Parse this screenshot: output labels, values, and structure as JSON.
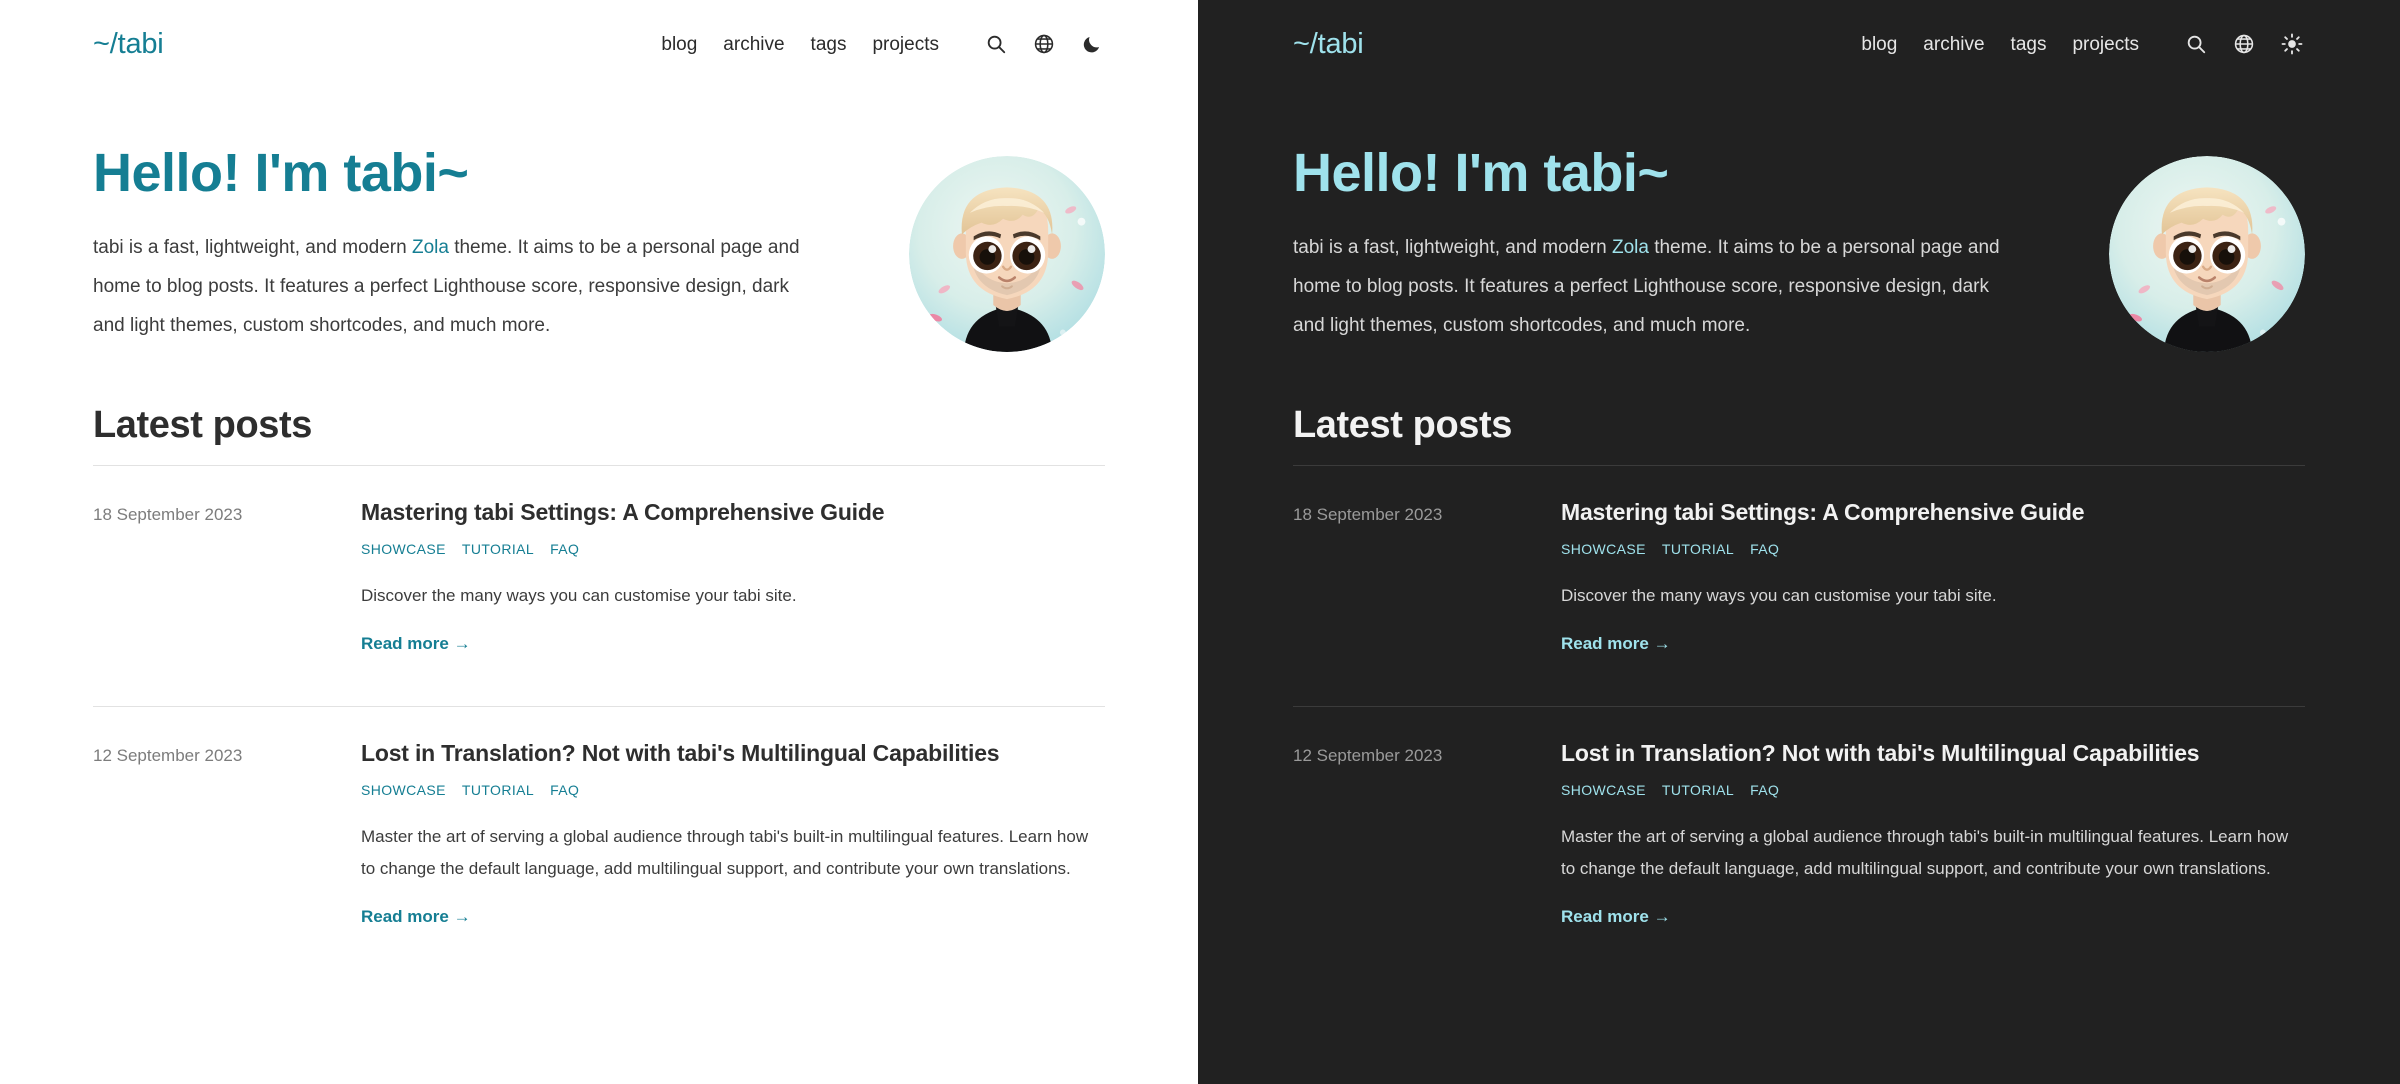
{
  "theme_variants": [
    {
      "id": "light",
      "mode_label": "light",
      "background": "#ffffff",
      "accent": "#157e93",
      "text": "#2b2b2b",
      "muted": "#7c7c7c",
      "theme_toggle_icon": "moon-icon"
    },
    {
      "id": "dark",
      "mode_label": "dark",
      "background": "#212121",
      "accent": "#9fe2ec",
      "text": "#e6e6e6",
      "muted": "#9a9a9a",
      "theme_toggle_icon": "sun-icon"
    }
  ],
  "header": {
    "logo": "~/tabi",
    "nav_links": [
      {
        "label": "blog"
      },
      {
        "label": "archive"
      },
      {
        "label": "tags"
      },
      {
        "label": "projects"
      }
    ],
    "icons": [
      {
        "name": "search-icon",
        "title": "Search"
      },
      {
        "name": "globe-icon",
        "title": "Language"
      },
      {
        "name": "theme-toggle-icon",
        "title": "Toggle theme"
      }
    ]
  },
  "hero": {
    "title": "Hello! I'm tabi~",
    "body_before_link": "tabi is a fast, lightweight, and modern ",
    "link_label": "Zola",
    "body_after_link": " theme. It aims to be a personal page and home to blog posts. It features a perfect Lighthouse score, responsive design, dark and light themes, custom shortcodes, and much more.",
    "avatar_alt": "tabi avatar"
  },
  "main": {
    "section_title": "Latest posts",
    "read_more_label": "Read more",
    "read_more_arrow": "→",
    "posts": [
      {
        "date": "18 September 2023",
        "title": "Mastering tabi Settings: A Comprehensive Guide",
        "tags": [
          "SHOWCASE",
          "TUTORIAL",
          "FAQ"
        ],
        "summary": "Discover the many ways you can customise your tabi site."
      },
      {
        "date": "12 September 2023",
        "title": "Lost in Translation? Not with tabi's Multilingual Capabilities",
        "tags": [
          "SHOWCASE",
          "TUTORIAL",
          "FAQ"
        ],
        "summary": "Master the art of serving a global audience through tabi's built-in multilingual features. Learn how to change the default language, add multilingual support, and contribute your own translations."
      }
    ]
  }
}
